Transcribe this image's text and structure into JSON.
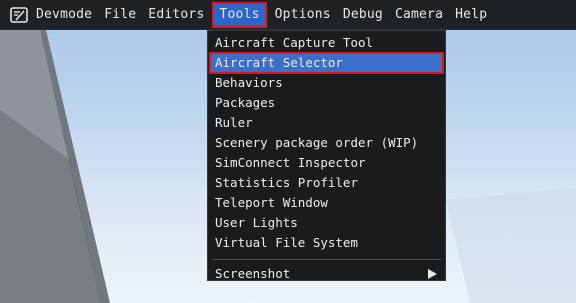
{
  "menubar": {
    "items": [
      {
        "label": "Devmode"
      },
      {
        "label": "File"
      },
      {
        "label": "Editors"
      },
      {
        "label": "Tools"
      },
      {
        "label": "Options"
      },
      {
        "label": "Debug"
      },
      {
        "label": "Camera"
      },
      {
        "label": "Help"
      }
    ],
    "active_item": "Tools",
    "accent_color": "#2f66c5",
    "highlight_border_color": "#e1161c"
  },
  "tools_menu": {
    "items": [
      {
        "label": "Aircraft Capture Tool"
      },
      {
        "label": "Aircraft Selector"
      },
      {
        "label": "Behaviors"
      },
      {
        "label": "Packages"
      },
      {
        "label": "Ruler"
      },
      {
        "label": "Scenery package order (WIP)"
      },
      {
        "label": "SimConnect Inspector"
      },
      {
        "label": "Statistics Profiler"
      },
      {
        "label": "Teleport Window"
      },
      {
        "label": "User Lights"
      },
      {
        "label": "Virtual File System"
      }
    ],
    "highlighted_item": "Aircraft Selector",
    "submenu_items": [
      {
        "label": "Screenshot",
        "icon": "submenu-arrow-icon"
      }
    ]
  },
  "icons": {
    "app": "devmode-logo-icon"
  }
}
